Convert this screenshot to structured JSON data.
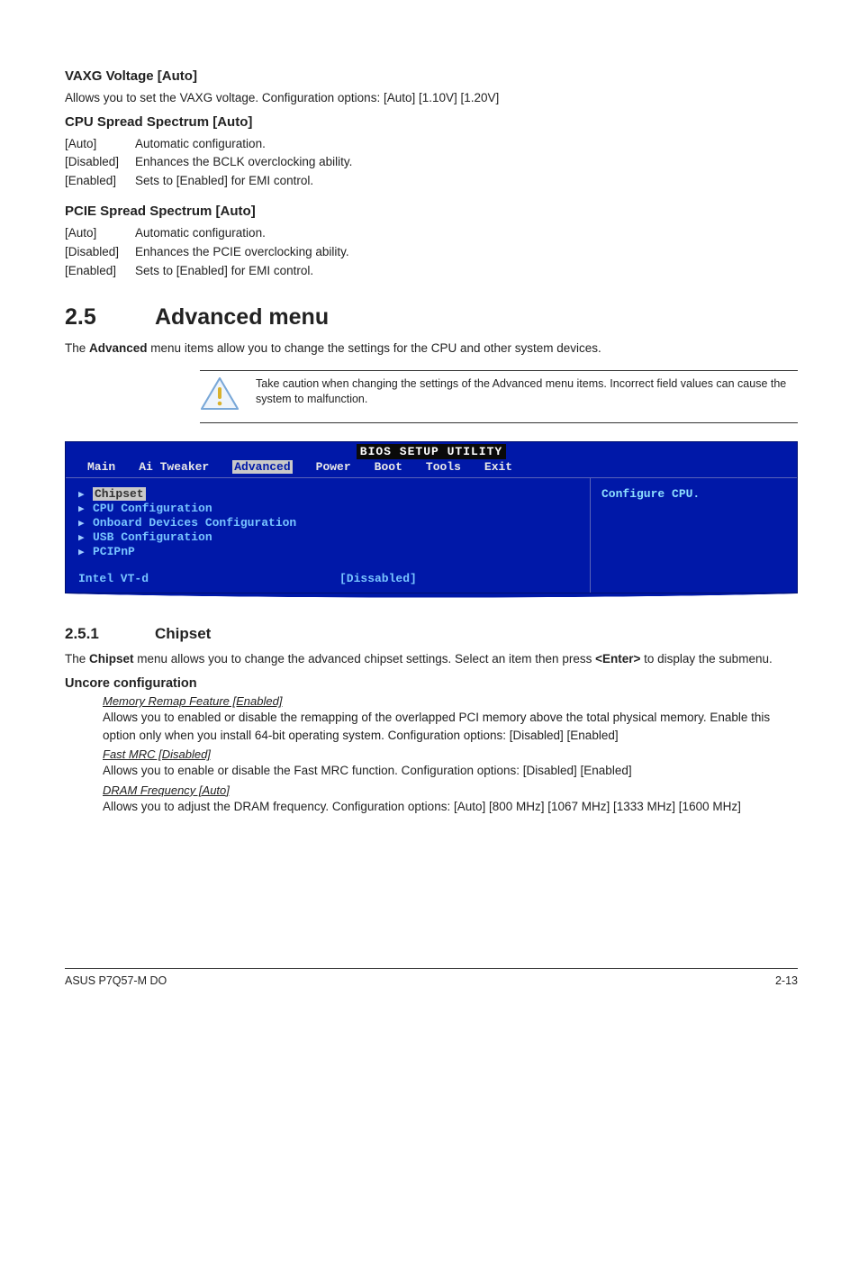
{
  "s1": {
    "heading": "VAXG Voltage [Auto]",
    "text": "Allows you to set the VAXG voltage. Configuration options: [Auto] [1.10V] [1.20V]"
  },
  "s2": {
    "heading": "CPU Spread Spectrum [Auto]",
    "rows": [
      {
        "k": "[Auto]",
        "v": "Automatic configuration."
      },
      {
        "k": "[Disabled]",
        "v": "Enhances the BCLK overclocking ability."
      },
      {
        "k": "[Enabled]",
        "v": "Sets to [Enabled] for EMI control."
      }
    ]
  },
  "s3": {
    "heading": "PCIE Spread Spectrum [Auto]",
    "rows": [
      {
        "k": "[Auto]",
        "v": "Automatic configuration."
      },
      {
        "k": "[Disabled]",
        "v": "Enhances the PCIE overclocking ability."
      },
      {
        "k": "[Enabled]",
        "v": "Sets to [Enabled] for EMI control."
      }
    ]
  },
  "advmenu": {
    "num": "2.5",
    "title": "Advanced menu",
    "intro_a": "The ",
    "intro_strong": "Advanced",
    "intro_b": " menu items allow you to change the settings for the CPU and other system devices."
  },
  "callout": {
    "text": "Take caution when changing the settings of the Advanced menu items. Incorrect field values can cause the system to malfunction."
  },
  "bios": {
    "title": "BIOS SETUP UTILITY",
    "tabs": [
      "Main",
      "Ai Tweaker",
      "Advanced",
      "Power",
      "Boot",
      "Tools",
      "Exit"
    ],
    "active_tab_index": 2,
    "menu": [
      {
        "label": "Chipset",
        "highlight": true
      },
      {
        "label": "CPU Configuration",
        "highlight": false
      },
      {
        "label": "Onboard Devices Configuration",
        "highlight": false
      },
      {
        "label": "USB Configuration",
        "highlight": false
      },
      {
        "label": "PCIPnP",
        "highlight": false
      }
    ],
    "row": {
      "label": "Intel VT-d",
      "value": "[Dissabled]"
    },
    "help": "Configure CPU."
  },
  "chipset": {
    "num": "2.5.1",
    "title": "Chipset",
    "intro_a": "The ",
    "intro_strong": "Chipset",
    "intro_b": " menu allows you to change the advanced chipset settings. Select an item then press ",
    "intro_strong2": "<Enter>",
    "intro_c": " to display the submenu."
  },
  "uncore": {
    "heading": "Uncore configuration",
    "items": [
      {
        "title": "Memory Remap Feature [Enabled]",
        "body": "Allows you to enabled or disable the remapping of the overlapped PCI memory above the total physical memory. Enable this option only when you install 64-bit operating system. Configuration options: [Disabled] [Enabled]"
      },
      {
        "title": "Fast MRC [Disabled]",
        "body": "Allows you to enable or disable the Fast MRC function. Configuration options: [Disabled] [Enabled]"
      },
      {
        "title": "DRAM Frequency [Auto]",
        "body": "Allows you to adjust the DRAM frequency. Configuration options: [Auto] [800 MHz] [1067 MHz] [1333 MHz] [1600 MHz]"
      }
    ]
  },
  "footer": {
    "left": "ASUS P7Q57-M DO",
    "right": "2-13"
  }
}
